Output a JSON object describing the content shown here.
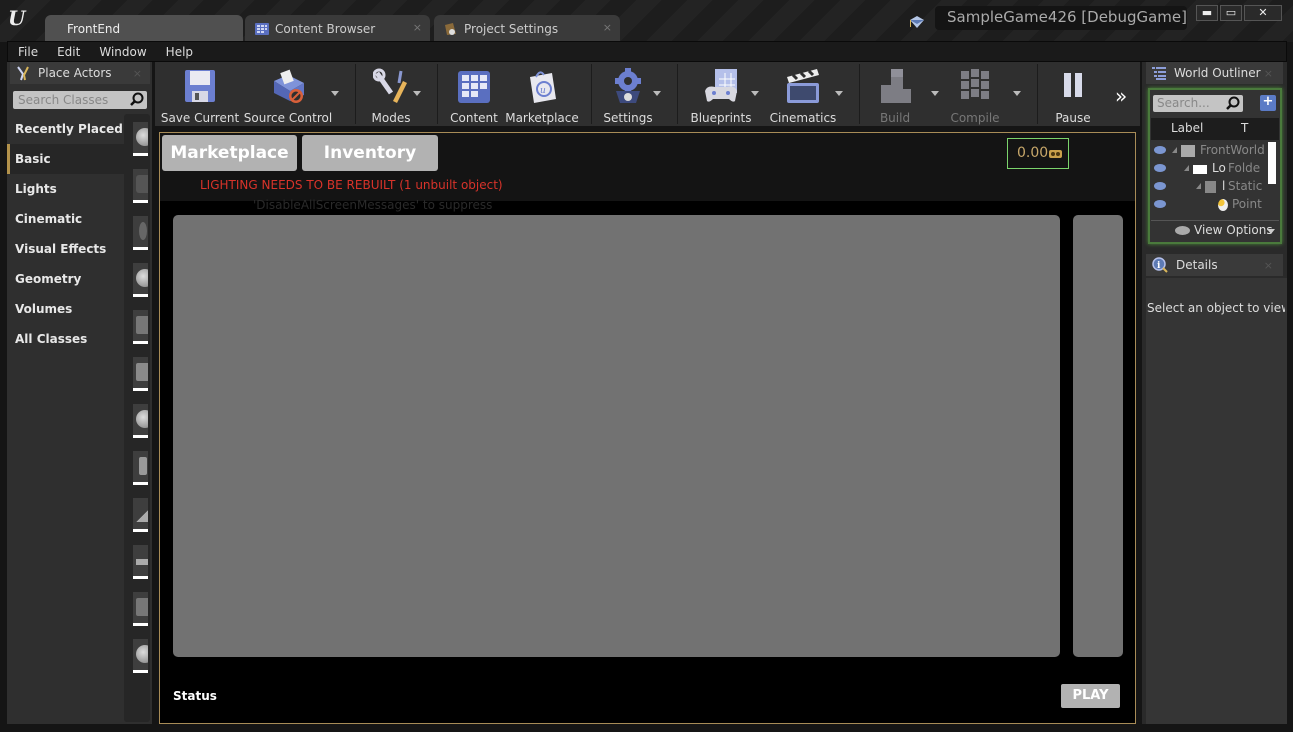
{
  "window": {
    "tabs": [
      {
        "label": "FrontEnd",
        "active": true,
        "icon": "none"
      },
      {
        "label": "Content Browser",
        "active": false,
        "icon": "content-browser-icon"
      },
      {
        "label": "Project Settings",
        "active": false,
        "icon": "project-settings-icon"
      }
    ],
    "tab_close_glyph": "×",
    "project_title": "SampleGame426 [DebugGame]",
    "controls": {
      "minimize": "▬",
      "maximize": "▭",
      "close": "✕"
    }
  },
  "menubar": {
    "items": [
      "File",
      "Edit",
      "Window",
      "Help"
    ]
  },
  "place_actors": {
    "title": "Place Actors",
    "close_glyph": "×",
    "search_placeholder": "Search Classes",
    "categories": [
      {
        "label": "Recently Placed",
        "selected": false
      },
      {
        "label": "Basic",
        "selected": true
      },
      {
        "label": "Lights",
        "selected": false
      },
      {
        "label": "Cinematic",
        "selected": false
      },
      {
        "label": "Visual Effects",
        "selected": false
      },
      {
        "label": "Geometry",
        "selected": false
      },
      {
        "label": "Volumes",
        "selected": false
      },
      {
        "label": "All Classes",
        "selected": false
      }
    ]
  },
  "toolbar": {
    "buttons": [
      {
        "label": "Save Current",
        "icon": "save-icon",
        "dropdown": false,
        "enabled": true
      },
      {
        "label": "Source Control",
        "icon": "source-control-icon",
        "dropdown": true,
        "enabled": true
      },
      {
        "label": "Modes",
        "icon": "modes-icon",
        "dropdown": true,
        "enabled": true
      },
      {
        "label": "Content",
        "icon": "content-icon",
        "dropdown": false,
        "enabled": true
      },
      {
        "label": "Marketplace",
        "icon": "marketplace-icon",
        "dropdown": false,
        "enabled": true
      },
      {
        "label": "Settings",
        "icon": "settings-icon",
        "dropdown": true,
        "enabled": true
      },
      {
        "label": "Blueprints",
        "icon": "blueprints-icon",
        "dropdown": true,
        "enabled": true
      },
      {
        "label": "Cinematics",
        "icon": "cinematics-icon",
        "dropdown": true,
        "enabled": true
      },
      {
        "label": "Build",
        "icon": "build-icon",
        "dropdown": true,
        "enabled": false
      },
      {
        "label": "Compile",
        "icon": "compile-icon",
        "dropdown": true,
        "enabled": false
      },
      {
        "label": "Pause",
        "icon": "pause-icon",
        "dropdown": false,
        "enabled": true
      }
    ],
    "more_glyph": "»"
  },
  "viewport": {
    "marketplace_button": "Marketplace",
    "inventory_button": "Inventory",
    "lighting_warning": "LIGHTING NEEDS TO BE REBUILT (1 unbuilt object)",
    "suppress_hint": "'DisableAllScreenMessages' to suppress",
    "gold_value": "0.00",
    "status_label": "Status",
    "play_button": "PLAY",
    "colors": {
      "warning": "#d8332a",
      "gold": "#c7a76a",
      "counter_border": "#7bd46c",
      "frame": "#a88c57"
    }
  },
  "world_outliner": {
    "title": "World Outliner",
    "close_glyph": "×",
    "search_placeholder": "Search...",
    "add_glyph": "+",
    "columns": {
      "label": "Label",
      "type": "T"
    },
    "rows": [
      {
        "name": "FrontWorld",
        "type": "",
        "indent": 0,
        "icon": "world-icon"
      },
      {
        "name": "Lo",
        "type": "Folde",
        "indent": 1,
        "icon": "folder-icon"
      },
      {
        "name": "l",
        "type": "Static",
        "indent": 2,
        "icon": "static-mesh-icon"
      },
      {
        "name": "",
        "type": "Point",
        "indent": 3,
        "icon": "point-light-icon"
      }
    ],
    "view_options": "View Options"
  },
  "details": {
    "title": "Details",
    "close_glyph": "×",
    "empty_message": "Select an object to view details."
  }
}
